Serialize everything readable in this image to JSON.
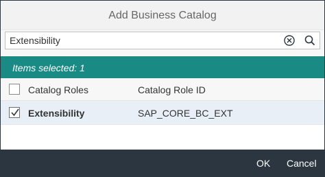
{
  "dialog": {
    "title": "Add Business Catalog",
    "background_title": "Add Business Catalog"
  },
  "search": {
    "value": "Extensibility",
    "clear_icon": "clear-circle-icon",
    "search_icon": "search-icon"
  },
  "status": {
    "text": "Items selected: 1"
  },
  "table": {
    "columns": [
      "Catalog Roles",
      "Catalog Role ID"
    ],
    "rows": [
      {
        "catalog_role": "Extensibility",
        "catalog_role_id": "SAP_CORE_BC_EXT",
        "selected": true
      }
    ]
  },
  "footer": {
    "ok_label": "OK",
    "cancel_label": "Cancel"
  },
  "colors": {
    "accent": "#1a8a84",
    "footer": "#2b3640",
    "selected_row": "#e8eff6"
  }
}
